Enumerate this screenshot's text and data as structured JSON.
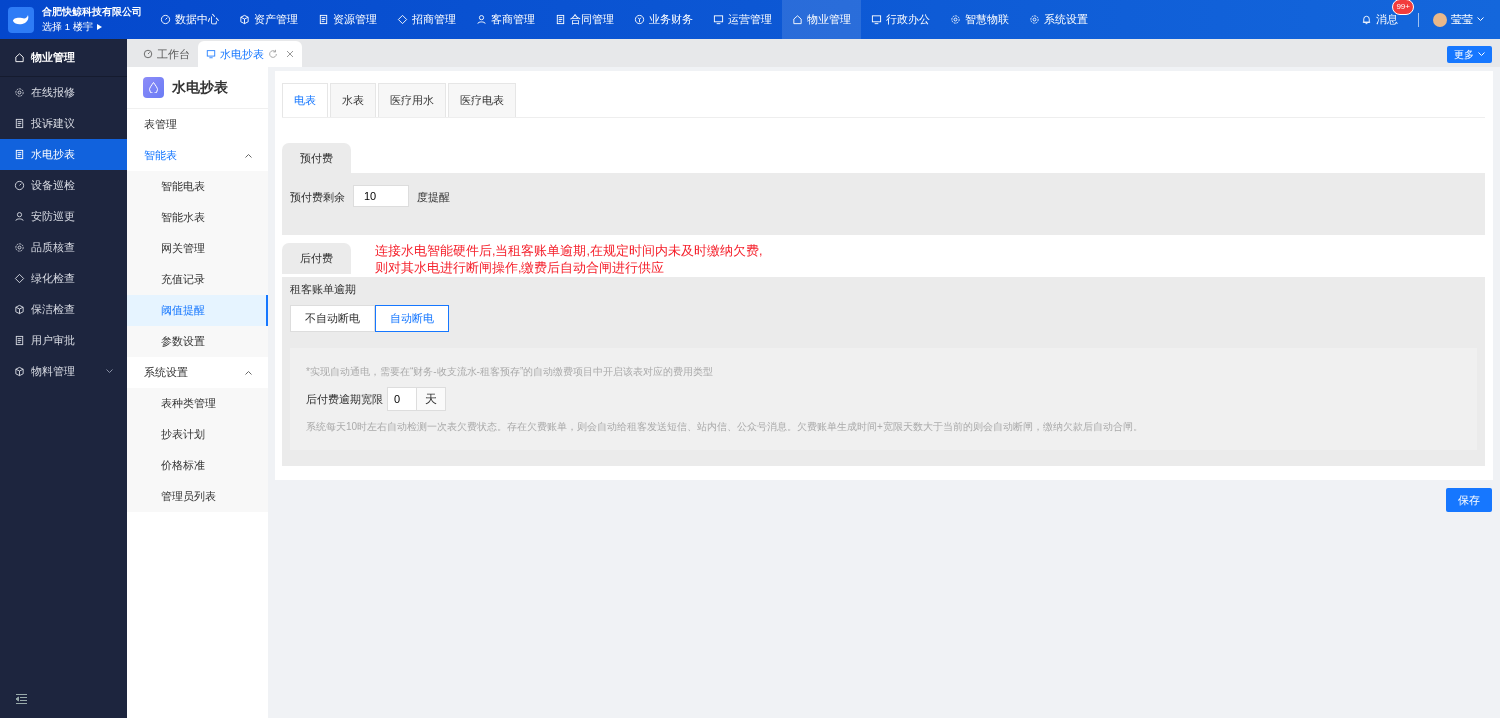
{
  "brand": {
    "company": "合肥快鲸科技有限公司",
    "building": "选择 1 楼宇"
  },
  "top_nav": [
    {
      "label": "数据中心",
      "selected": false
    },
    {
      "label": "资产管理",
      "selected": false
    },
    {
      "label": "资源管理",
      "selected": false
    },
    {
      "label": "招商管理",
      "selected": false
    },
    {
      "label": "客商管理",
      "selected": false
    },
    {
      "label": "合同管理",
      "selected": false
    },
    {
      "label": "业务财务",
      "selected": false
    },
    {
      "label": "运营管理",
      "selected": false
    },
    {
      "label": "物业管理",
      "selected": true
    },
    {
      "label": "行政办公",
      "selected": false
    },
    {
      "label": "智慧物联",
      "selected": false
    },
    {
      "label": "系统设置",
      "selected": false
    }
  ],
  "messages": {
    "label": "消息",
    "badge": "99+"
  },
  "user": {
    "name": "莹莹"
  },
  "sidebar": {
    "title": "物业管理",
    "items": [
      {
        "label": "在线报修",
        "selected": false
      },
      {
        "label": "投诉建议",
        "selected": false
      },
      {
        "label": "水电抄表",
        "selected": true
      },
      {
        "label": "设备巡检",
        "selected": false
      },
      {
        "label": "安防巡更",
        "selected": false
      },
      {
        "label": "品质核查",
        "selected": false
      },
      {
        "label": "绿化检查",
        "selected": false
      },
      {
        "label": "保洁检查",
        "selected": false
      },
      {
        "label": "用户审批",
        "selected": false
      },
      {
        "label": "物料管理",
        "selected": false,
        "expanded": false
      }
    ]
  },
  "page_tabs": [
    {
      "label": "工作台",
      "selected": false
    },
    {
      "label": "水电抄表",
      "selected": true
    }
  ],
  "more_button": "更多",
  "submenu": {
    "title": "水电抄表",
    "items": [
      {
        "label": "表管理",
        "selected": false
      },
      {
        "label": "智能表",
        "selected": false,
        "expanded": true,
        "children": [
          {
            "label": "智能电表",
            "selected": false
          },
          {
            "label": "智能水表",
            "selected": false
          },
          {
            "label": "网关管理",
            "selected": false
          },
          {
            "label": "充值记录",
            "selected": false
          },
          {
            "label": "阈值提醒",
            "selected": true
          },
          {
            "label": "参数设置",
            "selected": false
          }
        ]
      },
      {
        "label": "系统设置",
        "selected": false,
        "expanded": true,
        "children": [
          {
            "label": "表种类管理",
            "selected": false
          },
          {
            "label": "抄表计划",
            "selected": false
          },
          {
            "label": "价格标准",
            "selected": false
          },
          {
            "label": "管理员列表",
            "selected": false
          }
        ]
      }
    ]
  },
  "meter_tabs": [
    {
      "label": "电表",
      "selected": true
    },
    {
      "label": "水表",
      "selected": false
    },
    {
      "label": "医疗用水",
      "selected": false
    },
    {
      "label": "医疗电表",
      "selected": false
    }
  ],
  "prepaid": {
    "tab": "预付费",
    "label": "预付费剩余",
    "value": "10",
    "suffix": "度提醒"
  },
  "postpaid": {
    "tab": "后付费",
    "note_lines": [
      "连接水电智能硬件后,当租客账单逾期,在规定时间内未及时缴纳欠费,",
      "则对其水电进行断闸操作,缴费后自动合闸进行供应"
    ],
    "overdue_label": "租客账单逾期",
    "options": [
      {
        "label": "不自动断电",
        "selected": false
      },
      {
        "label": "自动断电",
        "selected": true
      }
    ],
    "hint": "*实现自动通电，需要在“财务-收支流水-租客预存”的自动缴费项目中开启该表对应的费用类型",
    "grace_label": "后付费逾期宽限",
    "grace_value": "0",
    "grace_unit": "天",
    "description": "系统每天10时左右自动检测一次表欠费状态。存在欠费账单，则会自动给租客发送短信、站内信、公众号消息。欠费账单生成时间+宽限天数大于当前的则会自动断闸，缴纳欠款后自动合闸。"
  },
  "save_button": "保存"
}
